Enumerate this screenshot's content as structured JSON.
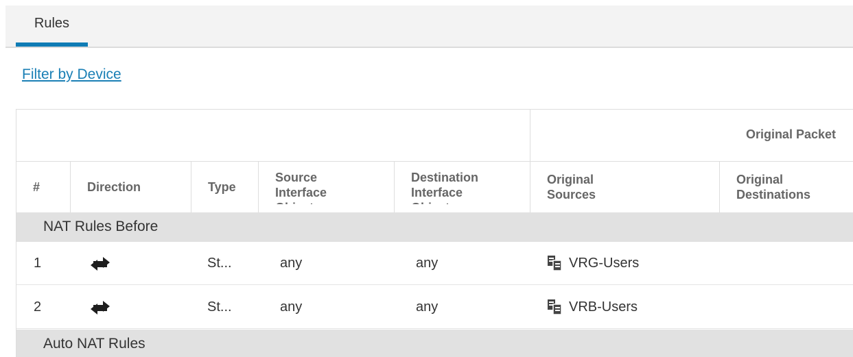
{
  "tabs": [
    {
      "label": "Rules",
      "active": true
    }
  ],
  "filter_link": "Filter by Device",
  "table": {
    "group_header": "Original Packet",
    "columns": {
      "number": "#",
      "direction": "Direction",
      "type": "Type",
      "source_interface": "Source Interface Objects",
      "destination_interface": "Destination Interface Objects",
      "original_sources": "Original Sources",
      "original_destinations": "Original Destinations"
    },
    "sections": [
      {
        "title": "NAT Rules Before",
        "rows": [
          {
            "number": "1",
            "direction_icon": "bidirectional-arrows-icon",
            "type": "St...",
            "source_interface": "any",
            "destination_interface": "any",
            "source_icon": "network-object-group-icon",
            "original_sources": "VRG-Users",
            "original_destinations": ""
          },
          {
            "number": "2",
            "direction_icon": "bidirectional-arrows-icon",
            "type": "St...",
            "source_interface": "any",
            "destination_interface": "any",
            "source_icon": "network-object-group-icon",
            "original_sources": "VRB-Users",
            "original_destinations": ""
          }
        ]
      },
      {
        "title": "Auto NAT Rules",
        "rows": []
      }
    ]
  },
  "colors": {
    "accent": "#0f7cb5",
    "link": "#1a7fb5",
    "section_bg": "#e1e1e1"
  }
}
